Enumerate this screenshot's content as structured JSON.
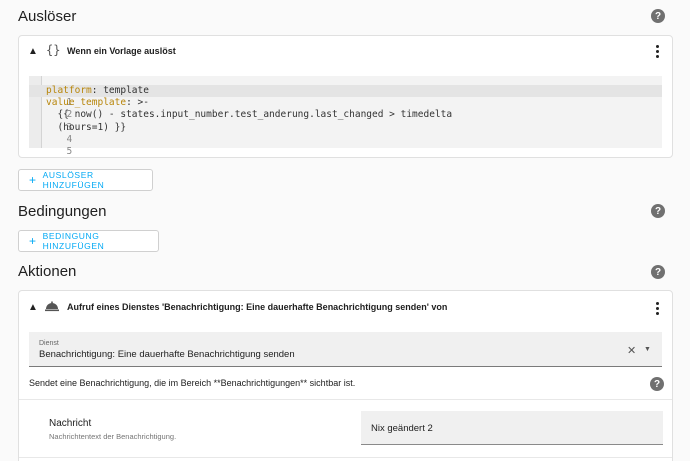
{
  "triggers": {
    "title": "Auslöser",
    "card": {
      "icon": "{}",
      "title": "Wenn ein Vorlage auslöst",
      "code_lines": [
        {
          "num": "1",
          "key": "platform",
          "rest": ": template"
        },
        {
          "num": "2",
          "key": "value_template",
          "rest": ": >-"
        },
        {
          "num": "3",
          "key": "",
          "rest": "  {{ now() - states.input_number.test_anderung.last_changed > timedelta"
        },
        {
          "num": "4",
          "key": "",
          "rest": "  (hours=1) }}"
        },
        {
          "num": "5",
          "key": "",
          "rest": ""
        }
      ]
    },
    "add_label": "AUSLÖSER HINZUFÜGEN"
  },
  "conditions": {
    "title": "Bedingungen",
    "add_label": "BEDINGUNG HINZUFÜGEN"
  },
  "actions": {
    "title": "Aktionen",
    "card": {
      "title": "Aufruf eines Dienstes 'Benachrichtigung: Eine dauerhafte Benachrichtigung senden' von",
      "service_label": "Dienst",
      "service_value": "Benachrichtigung: Eine dauerhafte Benachrichtigung senden",
      "description": "Sendet eine Benachrichtigung, die im Bereich **Benachrichtigungen** sichtbar ist.",
      "field_name": "Nachricht",
      "field_hint": "Nachrichtentext der Benachrichtigung.",
      "field_value": "Nix geändert 2"
    }
  },
  "icons": {
    "help": "?",
    "plus": "+",
    "chevron_up": "▲",
    "clear": "✕",
    "dropdown": "▼"
  }
}
